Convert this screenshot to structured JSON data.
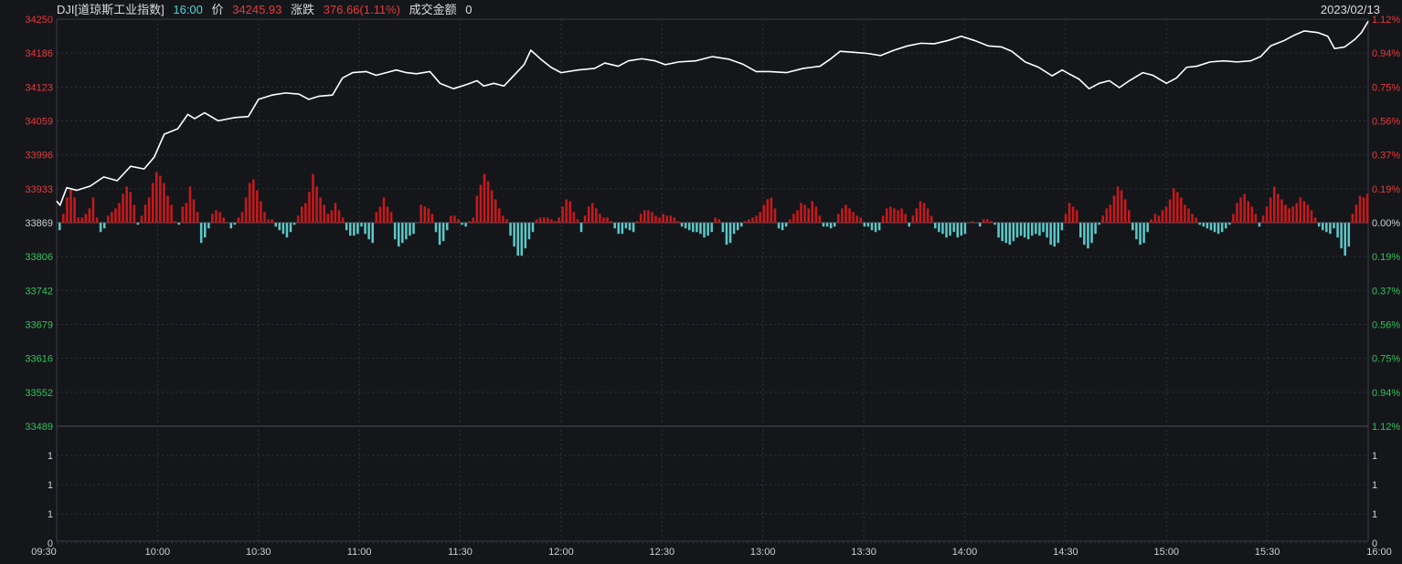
{
  "header": {
    "symbol": "DJI[道琼斯工业指数]",
    "time": "16:00",
    "price_label": "价",
    "price": "34245.93",
    "change_label": "涨跌",
    "change": "376.66(1.11%)",
    "amount_label": "成交金额",
    "amount": "0",
    "date": "2023/02/13"
  },
  "colors": {
    "background": "#14161a",
    "up": "#c8191c",
    "down": "#5cc8c8",
    "price_line": "#ffffff",
    "label_red": "#e8393b",
    "label_green": "#2fc45a",
    "grid": "#2e3238"
  },
  "chart_data": {
    "type": "line",
    "base_price": 33869,
    "y_left_ticks": [
      "34250",
      "34186",
      "34123",
      "34059",
      "33996",
      "33933",
      "33869",
      "33806",
      "33742",
      "33679",
      "33616",
      "33552",
      "33489"
    ],
    "y_right_ticks": [
      "1.12%",
      "0.94%",
      "0.75%",
      "0.56%",
      "0.37%",
      "0.19%",
      "0.00%",
      "0.19%",
      "0.37%",
      "0.56%",
      "0.75%",
      "0.94%",
      "1.12%"
    ],
    "ylim": [
      33489,
      34250
    ],
    "x_ticks": [
      "09:30",
      "10:00",
      "10:30",
      "11:00",
      "11:30",
      "12:00",
      "12:30",
      "13:00",
      "13:30",
      "14:00",
      "14:30",
      "15:00",
      "15:30",
      "16:00"
    ],
    "volume_ticks": [
      "1",
      "1",
      "1",
      "0"
    ],
    "price_series": {
      "name": "",
      "points": [
        [
          "09:30",
          33910
        ],
        [
          "09:31",
          33902
        ],
        [
          "09:33",
          33935
        ],
        [
          "09:36",
          33930
        ],
        [
          "09:40",
          33938
        ],
        [
          "09:44",
          33955
        ],
        [
          "09:48",
          33948
        ],
        [
          "09:52",
          33975
        ],
        [
          "09:56",
          33970
        ],
        [
          "09:59",
          33992
        ],
        [
          "10:02",
          34035
        ],
        [
          "10:06",
          34045
        ],
        [
          "10:09",
          34072
        ],
        [
          "10:11",
          34064
        ],
        [
          "10:14",
          34075
        ],
        [
          "10:18",
          34060
        ],
        [
          "10:23",
          34066
        ],
        [
          "10:27",
          34068
        ],
        [
          "10:30",
          34100
        ],
        [
          "10:34",
          34108
        ],
        [
          "10:38",
          34112
        ],
        [
          "10:42",
          34110
        ],
        [
          "10:45",
          34100
        ],
        [
          "10:48",
          34106
        ],
        [
          "10:52",
          34108
        ],
        [
          "10:55",
          34140
        ],
        [
          "10:58",
          34150
        ],
        [
          "11:02",
          34152
        ],
        [
          "11:05",
          34145
        ],
        [
          "11:08",
          34150
        ],
        [
          "11:11",
          34155
        ],
        [
          "11:14",
          34150
        ],
        [
          "11:17",
          34148
        ],
        [
          "11:21",
          34152
        ],
        [
          "11:24",
          34130
        ],
        [
          "11:28",
          34120
        ],
        [
          "11:32",
          34128
        ],
        [
          "11:35",
          34135
        ],
        [
          "11:37",
          34125
        ],
        [
          "11:40",
          34130
        ],
        [
          "11:43",
          34125
        ],
        [
          "11:46",
          34145
        ],
        [
          "11:49",
          34165
        ],
        [
          "11:51",
          34192
        ],
        [
          "11:54",
          34175
        ],
        [
          "11:57",
          34160
        ],
        [
          "12:00",
          34150
        ],
        [
          "12:05",
          34155
        ],
        [
          "12:10",
          34158
        ],
        [
          "12:13",
          34168
        ],
        [
          "12:17",
          34162
        ],
        [
          "12:20",
          34172
        ],
        [
          "12:24",
          34176
        ],
        [
          "12:28",
          34172
        ],
        [
          "12:31",
          34165
        ],
        [
          "12:35",
          34170
        ],
        [
          "12:40",
          34172
        ],
        [
          "12:45",
          34180
        ],
        [
          "12:50",
          34175
        ],
        [
          "12:54",
          34166
        ],
        [
          "12:58",
          34152
        ],
        [
          "13:02",
          34152
        ],
        [
          "13:07",
          34150
        ],
        [
          "13:12",
          34158
        ],
        [
          "13:17",
          34162
        ],
        [
          "13:20",
          34175
        ],
        [
          "13:23",
          34190
        ],
        [
          "13:27",
          34188
        ],
        [
          "13:31",
          34186
        ],
        [
          "13:35",
          34182
        ],
        [
          "13:39",
          34192
        ],
        [
          "13:43",
          34200
        ],
        [
          "13:47",
          34205
        ],
        [
          "13:51",
          34204
        ],
        [
          "13:55",
          34210
        ],
        [
          "13:59",
          34218
        ],
        [
          "14:03",
          34210
        ],
        [
          "14:07",
          34200
        ],
        [
          "14:11",
          34198
        ],
        [
          "14:14",
          34190
        ],
        [
          "14:18",
          34170
        ],
        [
          "14:22",
          34160
        ],
        [
          "14:26",
          34144
        ],
        [
          "14:29",
          34155
        ],
        [
          "14:31",
          34148
        ],
        [
          "14:34",
          34138
        ],
        [
          "14:37",
          34120
        ],
        [
          "14:40",
          34130
        ],
        [
          "14:43",
          34135
        ],
        [
          "14:46",
          34122
        ],
        [
          "14:49",
          34135
        ],
        [
          "14:53",
          34150
        ],
        [
          "14:56",
          34145
        ],
        [
          "15:00",
          34130
        ],
        [
          "15:03",
          34140
        ],
        [
          "15:06",
          34160
        ],
        [
          "15:09",
          34162
        ],
        [
          "15:13",
          34170
        ],
        [
          "15:17",
          34172
        ],
        [
          "15:21",
          34170
        ],
        [
          "15:25",
          34172
        ],
        [
          "15:28",
          34180
        ],
        [
          "15:31",
          34200
        ],
        [
          "15:35",
          34210
        ],
        [
          "15:38",
          34220
        ],
        [
          "15:41",
          34228
        ],
        [
          "15:45",
          34225
        ],
        [
          "15:48",
          34218
        ],
        [
          "15:50",
          34195
        ],
        [
          "15:53",
          34198
        ],
        [
          "15:56",
          34212
        ],
        [
          "15:58",
          34225
        ],
        [
          "16:00",
          34245.93
        ]
      ]
    },
    "change_bars": [
      -0.04,
      0.05,
      0.14,
      0.19,
      0.14,
      0.03,
      0.03,
      0.05,
      0.08,
      0.14,
      0.03,
      -0.05,
      -0.03,
      0.04,
      0.06,
      0.08,
      0.11,
      0.16,
      0.2,
      0.17,
      0.1,
      -0.01,
      0.04,
      0.1,
      0.14,
      0.22,
      0.28,
      0.26,
      0.22,
      0.15,
      0.1,
      0.01,
      -0.01,
      0.09,
      0.11,
      0.2,
      0.13,
      0.06,
      -0.11,
      -0.08,
      -0.03,
      0.05,
      0.07,
      0.06,
      0.03,
      0.0,
      -0.03,
      -0.01,
      0.03,
      0.06,
      0.14,
      0.22,
      0.24,
      0.18,
      0.12,
      0.06,
      0.02,
      0.02,
      -0.02,
      -0.04,
      -0.06,
      -0.08,
      -0.05,
      -0.01,
      0.04,
      0.09,
      0.11,
      0.17,
      0.27,
      0.2,
      0.14,
      0.1,
      0.05,
      0.07,
      0.11,
      0.07,
      0.03,
      -0.04,
      -0.07,
      -0.07,
      -0.06,
      -0.02,
      -0.06,
      -0.09,
      -0.11,
      0.06,
      0.09,
      0.14,
      0.09,
      0.06,
      -0.09,
      -0.13,
      -0.11,
      -0.09,
      -0.07,
      -0.06,
      0.0,
      0.1,
      0.09,
      0.08,
      0.05,
      -0.05,
      -0.12,
      -0.1,
      -0.04,
      0.04,
      0.04,
      0.02,
      -0.01,
      -0.02,
      0.01,
      0.03,
      0.15,
      0.21,
      0.27,
      0.23,
      0.18,
      0.13,
      0.08,
      0.04,
      0.02,
      -0.07,
      -0.13,
      -0.18,
      -0.18,
      -0.14,
      -0.09,
      -0.05,
      0.02,
      0.03,
      0.03,
      0.03,
      0.02,
      0.01,
      0.03,
      0.09,
      0.13,
      0.12,
      0.06,
      0.02,
      -0.05,
      0.04,
      0.09,
      0.11,
      0.08,
      0.05,
      0.03,
      0.03,
      0.01,
      -0.03,
      -0.06,
      -0.06,
      -0.03,
      -0.04,
      -0.05,
      0.01,
      0.05,
      0.07,
      0.07,
      0.06,
      0.04,
      0.03,
      0.05,
      0.04,
      0.04,
      0.03,
      0.01,
      -0.02,
      -0.03,
      -0.04,
      -0.05,
      -0.05,
      -0.06,
      -0.08,
      -0.07,
      -0.05,
      0.03,
      0.02,
      -0.05,
      -0.12,
      -0.11,
      -0.06,
      -0.04,
      -0.02,
      0.01,
      0.02,
      0.03,
      0.04,
      0.06,
      0.1,
      0.13,
      0.14,
      0.08,
      -0.03,
      -0.04,
      -0.02,
      0.02,
      0.05,
      0.07,
      0.11,
      0.1,
      0.08,
      0.12,
      0.09,
      0.04,
      -0.02,
      -0.02,
      -0.03,
      -0.02,
      0.05,
      0.08,
      0.1,
      0.08,
      0.06,
      0.04,
      0.03,
      -0.02,
      -0.02,
      -0.04,
      -0.05,
      -0.04,
      0.04,
      0.08,
      0.09,
      0.08,
      0.07,
      0.08,
      0.05,
      -0.02,
      0.04,
      0.08,
      0.12,
      0.11,
      0.08,
      0.04,
      -0.03,
      -0.05,
      -0.06,
      -0.08,
      -0.07,
      -0.05,
      -0.08,
      -0.07,
      -0.06,
      0.0,
      0.01,
      0.0,
      -0.02,
      0.02,
      0.02,
      0.01,
      -0.01,
      -0.08,
      -0.1,
      -0.11,
      -0.12,
      -0.1,
      -0.08,
      -0.07,
      -0.08,
      -0.09,
      -0.07,
      -0.06,
      -0.07,
      -0.05,
      -0.08,
      -0.12,
      -0.13,
      -0.11,
      -0.04,
      0.05,
      0.11,
      0.09,
      0.07,
      -0.08,
      -0.12,
      -0.14,
      -0.11,
      -0.06,
      -0.01,
      0.04,
      0.08,
      0.1,
      0.15,
      0.2,
      0.18,
      0.13,
      0.07,
      -0.04,
      -0.09,
      -0.12,
      -0.11,
      -0.05,
      0.02,
      0.05,
      0.04,
      0.07,
      0.09,
      0.13,
      0.19,
      0.17,
      0.14,
      0.1,
      0.08,
      0.05,
      0.03,
      -0.01,
      -0.02,
      -0.03,
      -0.04,
      -0.05,
      -0.06,
      -0.05,
      -0.03,
      -0.01,
      0.05,
      0.11,
      0.14,
      0.16,
      0.12,
      0.09,
      0.05,
      -0.02,
      0.04,
      0.09,
      0.14,
      0.2,
      0.16,
      0.13,
      0.1,
      0.08,
      0.09,
      0.11,
      0.14,
      0.12,
      0.1,
      0.07,
      0.03,
      -0.02,
      -0.04,
      -0.05,
      -0.06,
      -0.03,
      -0.08,
      -0.14,
      -0.18,
      -0.13,
      0.05,
      0.1,
      0.15,
      0.14,
      0.16
    ]
  }
}
